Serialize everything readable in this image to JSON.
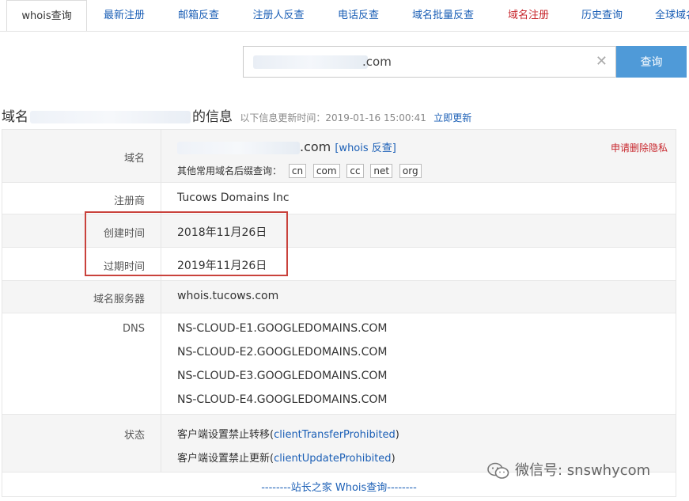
{
  "tabs": [
    {
      "label": "whois查询",
      "active": true
    },
    {
      "label": "最新注册"
    },
    {
      "label": "邮箱反查"
    },
    {
      "label": "注册人反查"
    },
    {
      "label": "电话反查"
    },
    {
      "label": "域名批量反查"
    },
    {
      "label": "域名注册",
      "highlight": true
    },
    {
      "label": "历史查询"
    },
    {
      "label": "全球域名"
    }
  ],
  "search": {
    "value_suffix": ".com",
    "button_label": "查询",
    "clear_glyph": "✕"
  },
  "heading": {
    "prefix": "域名",
    "suffix": "的信息",
    "meta": "以下信息更新时间：2019-01-16 15:00:41",
    "update_link": "立即更新"
  },
  "rows": {
    "domain": {
      "label": "域名",
      "value_suffix": ".com",
      "whois_link": "[whois 反查]",
      "privacy_link": "申请删除隐私",
      "suffix_prompt": "其他常用域名后缀查询：",
      "suffixes": [
        "cn",
        "com",
        "cc",
        "net",
        "org"
      ]
    },
    "registrar": {
      "label": "注册商",
      "value": "Tucows Domains Inc"
    },
    "created": {
      "label": "创建时间",
      "value": "2018年11月26日"
    },
    "expires": {
      "label": "过期时间",
      "value": "2019年11月26日"
    },
    "nameserver": {
      "label": "域名服务器",
      "value": "whois.tucows.com"
    },
    "dns": {
      "label": "DNS",
      "values": [
        "NS-CLOUD-E1.GOOGLEDOMAINS.COM",
        "NS-CLOUD-E2.GOOGLEDOMAINS.COM",
        "NS-CLOUD-E3.GOOGLEDOMAINS.COM",
        "NS-CLOUD-E4.GOOGLEDOMAINS.COM"
      ]
    },
    "status": {
      "label": "状态",
      "items": [
        {
          "text": "客户端设置禁止转移(",
          "link": "clientTransferProhibited",
          "close": ")"
        },
        {
          "text": "客户端设置禁止更新(",
          "link": "clientUpdateProhibited",
          "close": ")"
        }
      ]
    }
  },
  "footer_link": "--------站长之家 Whois查询--------",
  "watermark": "微信号: snswhycom",
  "colors": {
    "accent": "#4f9ad8",
    "link": "#1b5fb6",
    "alert": "#c8282e",
    "highlight_box": "#c9423c"
  }
}
